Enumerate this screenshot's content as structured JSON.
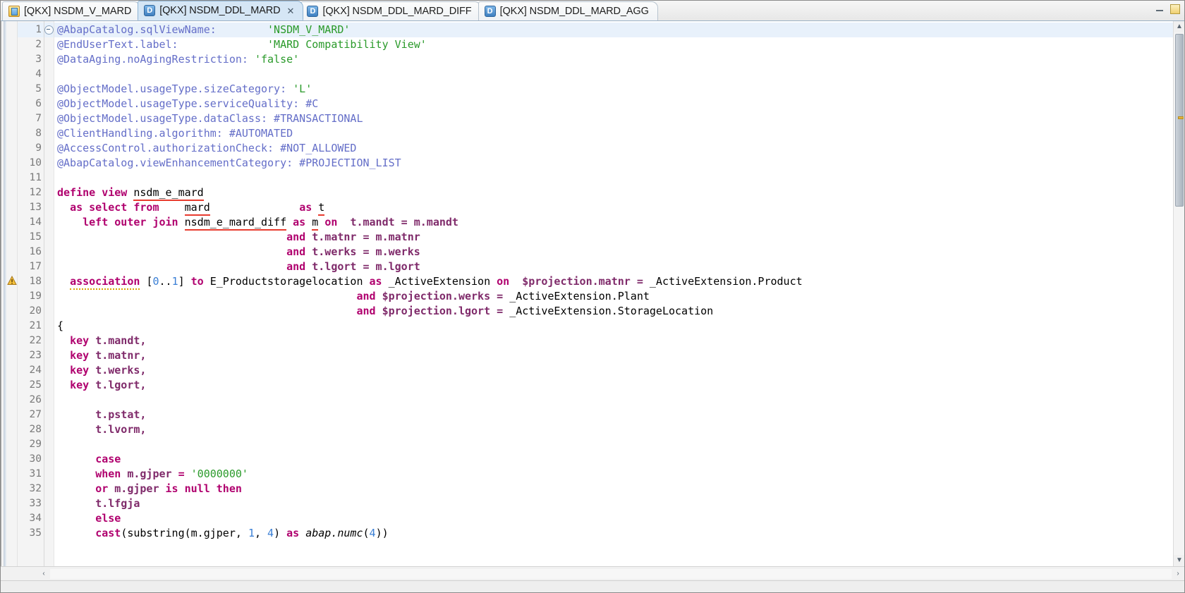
{
  "window": {
    "controls": [
      {
        "name": "minimize",
        "glyph": "—"
      },
      {
        "name": "restore",
        "glyph": "▭"
      }
    ]
  },
  "tabs": [
    {
      "label": "[QKX] NSDM_V_MARD",
      "icon": "view-icon",
      "icon_letter": "",
      "active": false,
      "closable": false
    },
    {
      "label": "[QKX] NSDM_DDL_MARD",
      "icon": "ddl-icon",
      "icon_letter": "D",
      "active": true,
      "closable": true,
      "close_glyph": "✕"
    },
    {
      "label": "[QKX] NSDM_DDL_MARD_DIFF",
      "icon": "ddl-icon",
      "icon_letter": "D",
      "active": false,
      "closable": false
    },
    {
      "label": "[QKX] NSDM_DDL_MARD_AGG",
      "icon": "ddl-icon",
      "icon_letter": "D",
      "active": false,
      "closable": false
    }
  ],
  "editor": {
    "first_line_folded": false,
    "fold_marker_line": 1,
    "warning_line": 18,
    "scrollbar": {
      "up_glyph": "▲",
      "down_glyph": "▼",
      "left_glyph": "‹",
      "right_glyph": "›"
    },
    "lines": [
      {
        "n": "1",
        "segs": [
          {
            "t": "ann",
            "x": "@AbapCatalog.sqlViewName:"
          },
          {
            "t": "plain",
            "x": "        "
          },
          {
            "t": "str",
            "x": "'NSDM_V_MARD'"
          }
        ]
      },
      {
        "n": "2",
        "segs": [
          {
            "t": "ann",
            "x": "@EndUserText.label:"
          },
          {
            "t": "plain",
            "x": "              "
          },
          {
            "t": "str",
            "x": "'MARD Compatibility View'"
          }
        ]
      },
      {
        "n": "3",
        "segs": [
          {
            "t": "ann",
            "x": "@DataAging.noAgingRestriction:"
          },
          {
            "t": "plain",
            "x": " "
          },
          {
            "t": "str",
            "x": "'false'"
          }
        ]
      },
      {
        "n": "4",
        "segs": []
      },
      {
        "n": "5",
        "segs": [
          {
            "t": "ann",
            "x": "@ObjectModel.usageType.sizeCategory:"
          },
          {
            "t": "plain",
            "x": " "
          },
          {
            "t": "str",
            "x": "'L'"
          }
        ]
      },
      {
        "n": "6",
        "segs": [
          {
            "t": "ann",
            "x": "@ObjectModel.usageType.serviceQuality:"
          },
          {
            "t": "plain",
            "x": " "
          },
          {
            "t": "enum",
            "x": "#C"
          }
        ]
      },
      {
        "n": "7",
        "segs": [
          {
            "t": "ann",
            "x": "@ObjectModel.usageType.dataClass:"
          },
          {
            "t": "plain",
            "x": " "
          },
          {
            "t": "enum",
            "x": "#TRANSACTIONAL"
          }
        ]
      },
      {
        "n": "8",
        "segs": [
          {
            "t": "ann",
            "x": "@ClientHandling.algorithm:"
          },
          {
            "t": "plain",
            "x": " "
          },
          {
            "t": "enum",
            "x": "#AUTOMATED"
          }
        ]
      },
      {
        "n": "9",
        "segs": [
          {
            "t": "ann",
            "x": "@AccessControl.authorizationCheck:"
          },
          {
            "t": "plain",
            "x": " "
          },
          {
            "t": "enum",
            "x": "#NOT_ALLOWED"
          }
        ]
      },
      {
        "n": "10",
        "segs": [
          {
            "t": "ann",
            "x": "@AbapCatalog.viewEnhancementCategory:"
          },
          {
            "t": "plain",
            "x": " "
          },
          {
            "t": "enum",
            "x": "#PROJECTION_LIST"
          }
        ]
      },
      {
        "n": "11",
        "segs": []
      },
      {
        "n": "12",
        "segs": [
          {
            "t": "kw",
            "x": "define view "
          },
          {
            "t": "id",
            "x": "nsdm_e_mard",
            "u": "red"
          }
        ]
      },
      {
        "n": "13",
        "segs": [
          {
            "t": "plain",
            "x": "  "
          },
          {
            "t": "kw",
            "x": "as select from"
          },
          {
            "t": "plain",
            "x": "    "
          },
          {
            "t": "id",
            "x": "mard",
            "u": "red"
          },
          {
            "t": "plain",
            "x": "              "
          },
          {
            "t": "kw",
            "x": "as "
          },
          {
            "t": "id",
            "x": "t",
            "u": "red"
          }
        ]
      },
      {
        "n": "14",
        "segs": [
          {
            "t": "plain",
            "x": "    "
          },
          {
            "t": "kw",
            "x": "left outer join "
          },
          {
            "t": "id",
            "x": "nsdm_e_mard_diff",
            "u": "red"
          },
          {
            "t": "plain",
            "x": " "
          },
          {
            "t": "kw",
            "x": "as "
          },
          {
            "t": "id",
            "x": "m",
            "u": "red"
          },
          {
            "t": "plain",
            "x": " "
          },
          {
            "t": "kw",
            "x": "on"
          },
          {
            "t": "plain",
            "x": "  "
          },
          {
            "t": "kw2",
            "x": "t.mandt = m.mandt"
          }
        ]
      },
      {
        "n": "15",
        "segs": [
          {
            "t": "plain",
            "x": "                                    "
          },
          {
            "t": "kw",
            "x": "and "
          },
          {
            "t": "kw2",
            "x": "t.matnr = m.matnr"
          }
        ]
      },
      {
        "n": "16",
        "segs": [
          {
            "t": "plain",
            "x": "                                    "
          },
          {
            "t": "kw",
            "x": "and "
          },
          {
            "t": "kw2",
            "x": "t.werks = m.werks"
          }
        ]
      },
      {
        "n": "17",
        "segs": [
          {
            "t": "plain",
            "x": "                                    "
          },
          {
            "t": "kw",
            "x": "and "
          },
          {
            "t": "kw2",
            "x": "t.lgort = m.lgort"
          }
        ]
      },
      {
        "n": "18",
        "segs": [
          {
            "t": "plain",
            "x": "  "
          },
          {
            "t": "kw",
            "x": "association",
            "u": "warn"
          },
          {
            "t": "plain",
            "x": " "
          },
          {
            "t": "plain",
            "x": "["
          },
          {
            "t": "num",
            "x": "0"
          },
          {
            "t": "plain",
            "x": ".."
          },
          {
            "t": "num",
            "x": "1"
          },
          {
            "t": "plain",
            "x": "] "
          },
          {
            "t": "kw",
            "x": "to "
          },
          {
            "t": "id",
            "x": "E_Productstoragelocation "
          },
          {
            "t": "kw",
            "x": "as "
          },
          {
            "t": "id",
            "x": "_ActiveExtension "
          },
          {
            "t": "kw",
            "x": "on"
          },
          {
            "t": "plain",
            "x": "  "
          },
          {
            "t": "kw2",
            "x": "$projection.matnr = "
          },
          {
            "t": "id",
            "x": "_ActiveExtension.Product"
          }
        ]
      },
      {
        "n": "19",
        "segs": [
          {
            "t": "plain",
            "x": "                                               "
          },
          {
            "t": "kw",
            "x": "and "
          },
          {
            "t": "kw2",
            "x": "$projection.werks = "
          },
          {
            "t": "id",
            "x": "_ActiveExtension.Plant"
          }
        ]
      },
      {
        "n": "20",
        "segs": [
          {
            "t": "plain",
            "x": "                                               "
          },
          {
            "t": "kw",
            "x": "and "
          },
          {
            "t": "kw2",
            "x": "$projection.lgort = "
          },
          {
            "t": "id",
            "x": "_ActiveExtension.StorageLocation"
          }
        ]
      },
      {
        "n": "21",
        "segs": [
          {
            "t": "plain",
            "x": "{"
          }
        ]
      },
      {
        "n": "22",
        "segs": [
          {
            "t": "plain",
            "x": "  "
          },
          {
            "t": "kw",
            "x": "key "
          },
          {
            "t": "kw2",
            "x": "t.mandt,"
          }
        ]
      },
      {
        "n": "23",
        "segs": [
          {
            "t": "plain",
            "x": "  "
          },
          {
            "t": "kw",
            "x": "key "
          },
          {
            "t": "kw2",
            "x": "t.matnr,"
          }
        ]
      },
      {
        "n": "24",
        "segs": [
          {
            "t": "plain",
            "x": "  "
          },
          {
            "t": "kw",
            "x": "key "
          },
          {
            "t": "kw2",
            "x": "t.werks,"
          }
        ]
      },
      {
        "n": "25",
        "segs": [
          {
            "t": "plain",
            "x": "  "
          },
          {
            "t": "kw",
            "x": "key "
          },
          {
            "t": "kw2",
            "x": "t.lgort,"
          }
        ]
      },
      {
        "n": "26",
        "segs": []
      },
      {
        "n": "27",
        "segs": [
          {
            "t": "plain",
            "x": "      "
          },
          {
            "t": "kw2",
            "x": "t.pstat,"
          }
        ]
      },
      {
        "n": "28",
        "segs": [
          {
            "t": "plain",
            "x": "      "
          },
          {
            "t": "kw2",
            "x": "t.lvorm,"
          }
        ]
      },
      {
        "n": "29",
        "segs": []
      },
      {
        "n": "30",
        "segs": [
          {
            "t": "plain",
            "x": "      "
          },
          {
            "t": "kw",
            "x": "case"
          }
        ]
      },
      {
        "n": "31",
        "segs": [
          {
            "t": "plain",
            "x": "      "
          },
          {
            "t": "kw",
            "x": "when "
          },
          {
            "t": "kw2",
            "x": "m.gjper "
          },
          {
            "t": "kw",
            "x": "= "
          },
          {
            "t": "str",
            "x": "'0000000'"
          }
        ]
      },
      {
        "n": "32",
        "segs": [
          {
            "t": "plain",
            "x": "      "
          },
          {
            "t": "kw",
            "x": "or "
          },
          {
            "t": "kw2",
            "x": "m.gjper "
          },
          {
            "t": "kw",
            "x": "is null then"
          }
        ]
      },
      {
        "n": "33",
        "segs": [
          {
            "t": "plain",
            "x": "      "
          },
          {
            "t": "kw2",
            "x": "t.lfgja"
          }
        ]
      },
      {
        "n": "34",
        "segs": [
          {
            "t": "plain",
            "x": "      "
          },
          {
            "t": "kw",
            "x": "else"
          }
        ]
      },
      {
        "n": "35",
        "segs": [
          {
            "t": "plain",
            "x": "      "
          },
          {
            "t": "kw",
            "x": "cast"
          },
          {
            "t": "plain",
            "x": "(substring(m.gjper, "
          },
          {
            "t": "num",
            "x": "1"
          },
          {
            "t": "plain",
            "x": ", "
          },
          {
            "t": "num",
            "x": "4"
          },
          {
            "t": "plain",
            "x": ") "
          },
          {
            "t": "kw",
            "x": "as "
          },
          {
            "t": "type",
            "x": "abap.numc"
          },
          {
            "t": "plain",
            "x": "("
          },
          {
            "t": "num",
            "x": "4"
          },
          {
            "t": "plain",
            "x": "))"
          }
        ]
      }
    ]
  },
  "colors": {
    "annotation": "#646ec8",
    "string": "#2a9a2a",
    "keyword": "#b0006e",
    "number": "#3a7fd5",
    "error_underline": "#e83b2e",
    "warning_underline": "#d8a400",
    "active_tab_bg": "#d5e6f5",
    "current_line_bg": "#e8f1fb"
  }
}
